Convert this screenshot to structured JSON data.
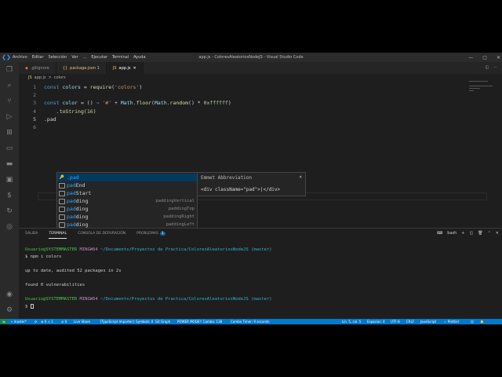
{
  "titlebar": {
    "menu": [
      "Archivo",
      "Editar",
      "Selección",
      "Ver",
      "...",
      "Ejecutar",
      "Terminal",
      "Ayuda"
    ],
    "title": "app.js - ColoresAleatoriosNodeJS - Visual Studio Code"
  },
  "tabs": [
    {
      "icon": "◆",
      "label": ".gitignore",
      "active": false
    },
    {
      "icon": "{}",
      "label": "package.json 1",
      "active": false,
      "modified": true
    },
    {
      "icon": "JS",
      "label": "app.js",
      "active": true
    }
  ],
  "breadcrumb": {
    "file": "app.js",
    "sep": ">",
    "symbol": "colors"
  },
  "editor": {
    "lines": [
      {
        "n": "1",
        "parts": [
          [
            "kw",
            "const "
          ],
          [
            "var",
            "colors"
          ],
          [
            "op",
            " = "
          ],
          [
            "fn",
            "require"
          ],
          [
            "op",
            "("
          ],
          [
            "str",
            "'colors'"
          ],
          [
            "op",
            ")"
          ]
        ]
      },
      {
        "n": "2",
        "parts": []
      },
      {
        "n": "3",
        "parts": [
          [
            "kw",
            "const "
          ],
          [
            "var",
            "color"
          ],
          [
            "op",
            " = () "
          ],
          [
            "kw",
            "⇒"
          ],
          [
            "op",
            " "
          ],
          [
            "str",
            "'#'"
          ],
          [
            "op",
            " + "
          ],
          [
            "var",
            "Math"
          ],
          [
            "op",
            "."
          ],
          [
            "fn",
            "floor"
          ],
          [
            "op",
            "("
          ],
          [
            "var",
            "Math"
          ],
          [
            "op",
            "."
          ],
          [
            "fn",
            "random"
          ],
          [
            "op",
            "() * "
          ],
          [
            "num",
            "0xffffff"
          ],
          [
            "op",
            ")"
          ]
        ]
      },
      {
        "n": "4",
        "parts": [
          [
            "op",
            "    ."
          ],
          [
            "fn",
            "toString"
          ],
          [
            "op",
            "("
          ],
          [
            "num",
            "16"
          ],
          [
            "op",
            ")"
          ]
        ]
      },
      {
        "n": "5",
        "parts": [
          [
            "op",
            ".pad"
          ]
        ]
      },
      {
        "n": "6",
        "parts": []
      }
    ]
  },
  "suggest": {
    "items": [
      {
        "icon": "key",
        "match": ".pad",
        "rest": "",
        "detail": ""
      },
      {
        "icon": "box",
        "match": "pad",
        "rest": "End",
        "detail": ""
      },
      {
        "icon": "box",
        "match": "pad",
        "rest": "Start",
        "detail": ""
      },
      {
        "icon": "box",
        "match": "pad",
        "rest": "ding",
        "detail": "paddingVertical"
      },
      {
        "icon": "box",
        "match": "pad",
        "rest": "ding",
        "detail": "paddingTop"
      },
      {
        "icon": "box",
        "match": "pad",
        "rest": "ding",
        "detail": "paddingRight"
      },
      {
        "icon": "box",
        "match": "pad",
        "rest": "ding",
        "detail": "paddingLeft"
      },
      {
        "icon": "box",
        "match": "pad",
        "rest": "ding",
        "detail": "paddingHorizontal"
      },
      {
        "icon": "box",
        "match": "pad",
        "rest": "ding",
        "detail": "paddingBottom"
      },
      {
        "icon": "box",
        "match": "pad",
        "rest": "ding",
        "detail": "padding"
      },
      {
        "icon": "box",
        "match": "",
        "rest": "b4-pagination-default",
        "detail": "b4-pagination-defa…"
      },
      {
        "icon": "box",
        "match": "",
        "rest": "fa5-palfed",
        "detail": "fa5-palfed"
      }
    ],
    "selected_index": 0
  },
  "details": {
    "header": "Emmet Abbreviation",
    "close": "×",
    "body": "<div className=\"pad\">|</div>"
  },
  "panel": {
    "tabs": [
      {
        "label": "SALIDA"
      },
      {
        "label": "TERMINAL",
        "active": true
      },
      {
        "label": "CONSOLA DE DEPURACIÓN"
      },
      {
        "label": "PROBLEMAS",
        "badge": "1"
      }
    ],
    "shell_label": "bash",
    "terminal": {
      "prompt1": {
        "user": "Usuario@SYSTEMMASTER",
        "host": " MINGW64 ",
        "path": "~/Documents/Proyectos de Practica/ColoresAleatoriosNodeJS",
        "branch": " (master)"
      },
      "cmd1": "$ npm i colors",
      "out1": "up to date, audited 52 packages in 2s",
      "out2": "found 0 vulnerabilities",
      "prompt2": {
        "user": "Usuario@SYSTEMMASTER",
        "host": " MINGW64 ",
        "path": "~/Documents/Proyectos de Practica/ColoresAleatoriosNodeJS",
        "branch": " (master)"
      },
      "cmd2": "$ "
    }
  },
  "status": {
    "branch": "master*",
    "sync": "⟳",
    "errors": "⊗ 0 ⚠ 1",
    "problems": "⊘ 0",
    "live_share": "Live Share",
    "ts_importer": "[TypeScript Importer]: Symbols: 0",
    "git_graph": "Git Graph",
    "power_mode": "POWER MODE!! Combo: 138",
    "combo_timer": "Combo Timer: 9 seconds",
    "position": "Lín. 5, col. 5",
    "spaces": "Espacios: 4",
    "encoding": "UTF-8",
    "eol": "CRLF",
    "language": "JavaScript",
    "formatter": "✓ Prettier"
  },
  "colors": {
    "accent": "#007acc",
    "editor_bg": "#1e1e1e",
    "selection": "#04395e"
  }
}
